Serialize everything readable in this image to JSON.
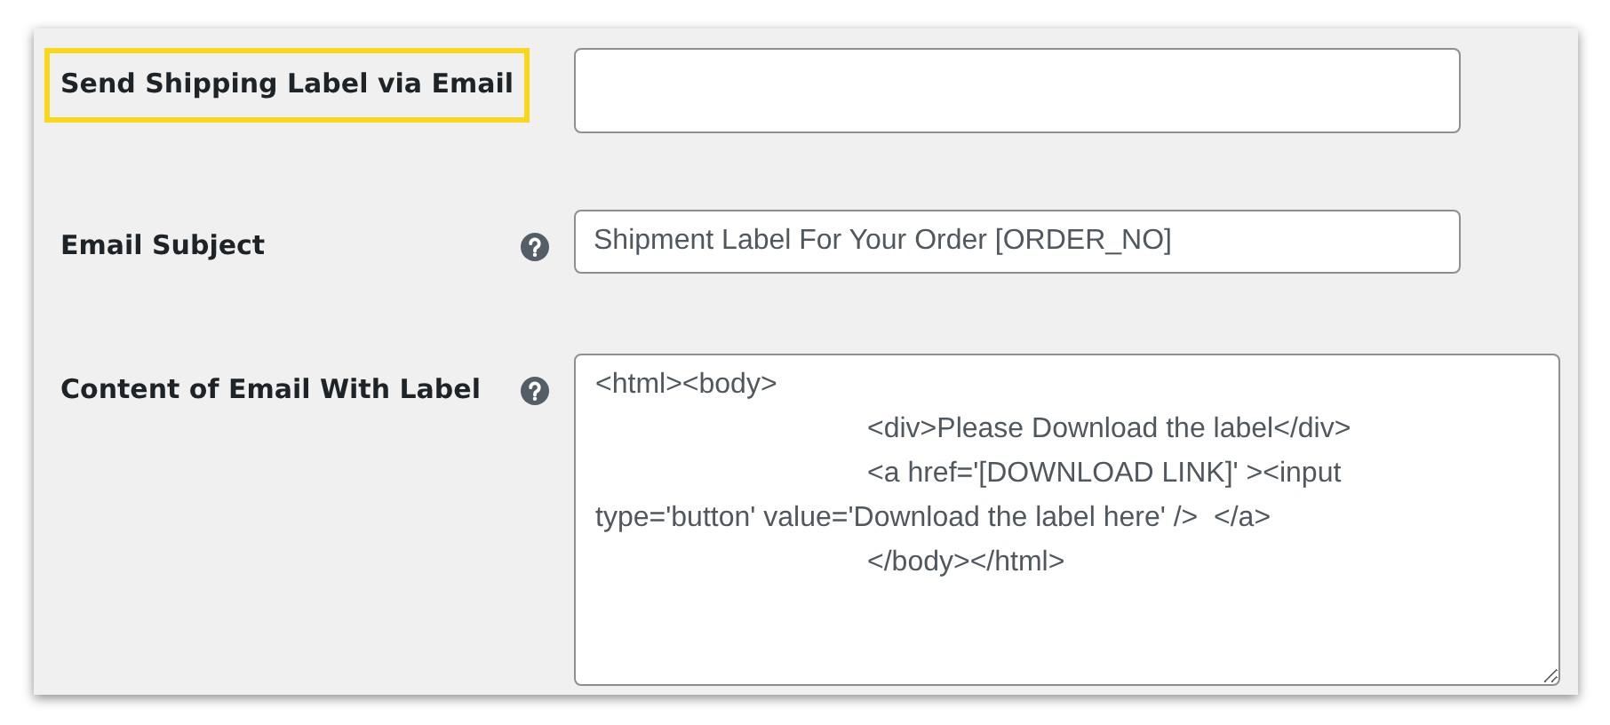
{
  "rows": [
    {
      "label": "Send Shipping Label via Email",
      "highlighted": true,
      "help": false,
      "kind": "input",
      "value": ""
    },
    {
      "label": "Email Subject",
      "highlighted": false,
      "help": true,
      "kind": "input",
      "value": "Shipment Label For Your Order [ORDER_NO]"
    },
    {
      "label": "Content of Email With Label",
      "highlighted": false,
      "help": true,
      "kind": "textarea",
      "value": "<html><body>\n\t\t\t<div>Please Download the label</div>\n\t\t\t<a href='[DOWNLOAD LINK]' ><input\ntype='button' value='Download the label here' />  </a>\n\t\t\t</body></html>"
    }
  ]
}
